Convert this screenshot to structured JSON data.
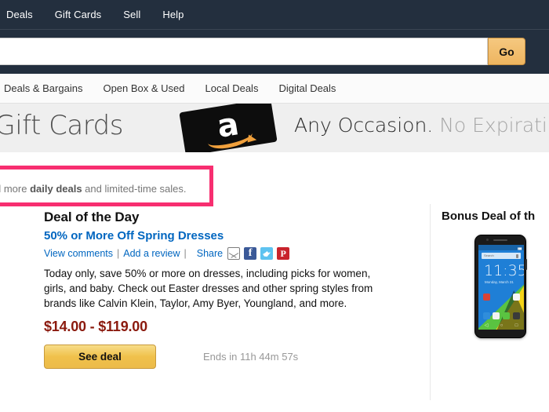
{
  "topnav": {
    "links": [
      {
        "label": "Deals",
        "name": "nav-deals"
      },
      {
        "label": "Gift Cards",
        "name": "nav-gift-cards"
      },
      {
        "label": "Sell",
        "name": "nav-sell"
      },
      {
        "label": "Help",
        "name": "nav-help"
      }
    ],
    "background": "#232f3e"
  },
  "search": {
    "value": "",
    "placeholder": "",
    "go_label": "Go",
    "go_color": "#eeb560"
  },
  "subnav": {
    "links": [
      {
        "label": "Deals & Bargains",
        "name": "subnav-deals-bargains"
      },
      {
        "label": "Open Box & Used",
        "name": "subnav-open-box-used"
      },
      {
        "label": "Local Deals",
        "name": "subnav-local-deals"
      },
      {
        "label": "Digital Deals",
        "name": "subnav-digital-deals"
      }
    ]
  },
  "banner": {
    "left_text": "n Gift Cards",
    "right_dark": "Any Occasion.",
    "right_gray": "No Expirati",
    "card_logo": "a",
    "background": "#efefef"
  },
  "annotation": {
    "text_prefix": "d more ",
    "text_bold": "daily deals",
    "text_suffix": " and limited-time sales.",
    "highlight_color": "#f72e70"
  },
  "deal": {
    "title": "Deal of the Day",
    "subtitle": "50% or More Off Spring Dresses",
    "view_comments": "View comments",
    "add_review": "Add a review",
    "separator": "|",
    "share_label": "Share",
    "share_icons": [
      {
        "name": "email-share-icon",
        "label": ""
      },
      {
        "name": "facebook-share-icon",
        "label": "f"
      },
      {
        "name": "twitter-share-icon",
        "label": ""
      },
      {
        "name": "pinterest-share-icon",
        "label": "P"
      }
    ],
    "description": "Today only, save 50% or more on dresses, including picks for women, girls, and baby. Check out Easter dresses and other spring styles from brands like Calvin Klein, Taylor, Amy Byer, Youngland, and more.",
    "price": "$14.00 - $119.00",
    "price_color": "#8b1a0e",
    "see_deal_label": "See deal",
    "ends_in": "Ends in 11h 44m 57s"
  },
  "bonus": {
    "title": "Bonus Deal of th",
    "phone": {
      "clock": "11:35",
      "date": "Monday, March 31",
      "search_placeholder": "Search"
    }
  }
}
